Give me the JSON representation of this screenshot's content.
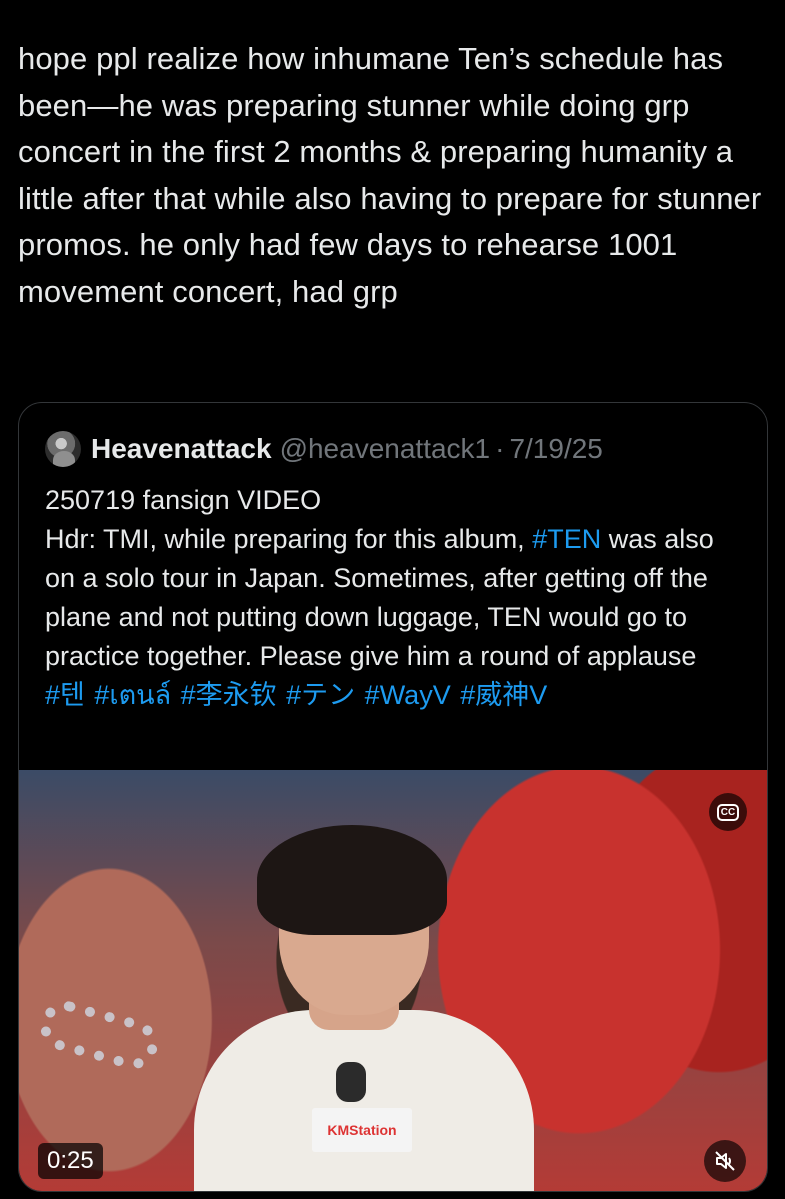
{
  "tweet": {
    "text": "hope ppl realize how inhumane Ten’s schedule has been—he was preparing stunner while doing grp concert in the first 2 months & preparing humanity a little after that while also having to prepare for stunner promos. he only had few days to rehearse 1001 movement concert, had grp"
  },
  "quote": {
    "display_name": "Heavenattack",
    "handle": "@heavenattack1",
    "separator": "·",
    "date": "7/19/25",
    "line1": "250719 fansign VIDEO",
    "hdr_before": "Hdr: TMI, while preparing for this album, ",
    "hdr_hashtag": "#TEN",
    "hdr_after": " was also on a solo tour in Japan. Sometimes, after getting off the plane and not putting down luggage, TEN would go to practice together. Please give him a round of applause",
    "hashtags": "#텐 #เตนล์ #李永钦 #テン #WayV #威神V"
  },
  "video": {
    "duration": "0:25",
    "mic_flag_text": "KMStation",
    "cc_icon": "cc-icon",
    "mute_icon": "muted-speaker-icon"
  },
  "colors": {
    "background": "#000000",
    "text": "#e7e9ea",
    "muted": "#71767b",
    "link": "#1d9bf0",
    "border": "#333639"
  }
}
